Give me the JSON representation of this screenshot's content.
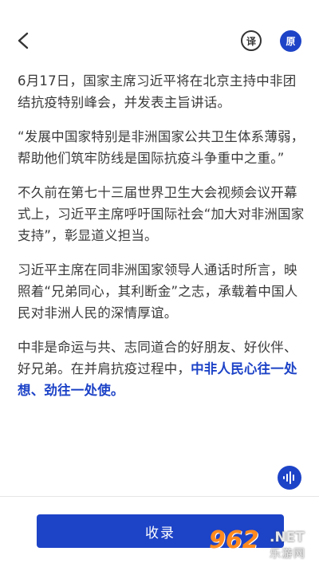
{
  "header": {
    "back_icon": "chevron-left-icon",
    "translate_label": "译",
    "original_label": "原"
  },
  "article": {
    "paragraphs": [
      "6月17日，国家主席习近平将在北京主持中非团结抗疫特别峰会，并发表主旨讲话。",
      "“发展中国家特别是非洲国家公共卫生体系薄弱，帮助他们筑牢防线是国际抗疫斗争重中之重。”",
      "不久前在第七十三届世界卫生大会视频会议开幕式上，习近平主席呼吁国际社会“加大对非洲国家支持”，彰显道义担当。",
      "习近平主席在同非洲国家领导人通话时所言，映照着“兄弟同心，其利断金”之志，承载着中国人民对非洲人民的深情厚谊。"
    ],
    "last_paragraph_plain": "中非是命运与共、志同道合的好朋友、好伙伴、好兄弟。在并肩抗疫过程中，",
    "last_paragraph_highlight": "中非人民心往一处想、劲往一处使。"
  },
  "audio": {
    "icon": "waveform-icon"
  },
  "footer": {
    "collect_label": "收录"
  },
  "watermark": {
    "logo": "962",
    "net": ".NET",
    "sub": "乐游网"
  },
  "colors": {
    "accent": "#1d43c7",
    "text": "#3a3a3a"
  }
}
